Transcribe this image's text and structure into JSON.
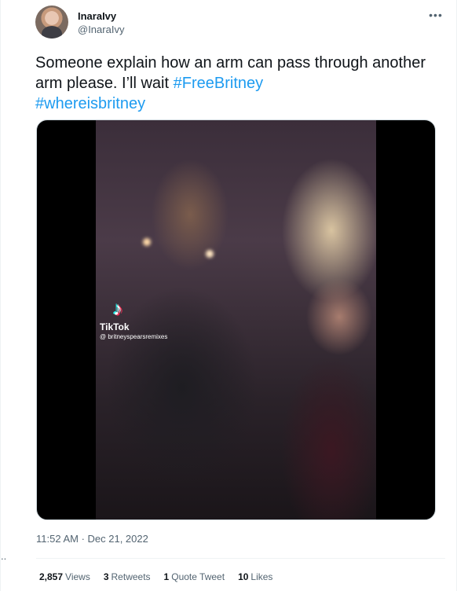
{
  "tweet": {
    "display_name": "InaraIvy",
    "handle": "@InaraIvy",
    "more_icon": "ellipsis-horizontal-icon",
    "text_plain": "Someone explain how an arm can pass through another arm please. I’ll wait ",
    "hashtags": [
      "#FreeBritney",
      "#whereisbritney"
    ],
    "timestamp": "11:52 AM · Dec 21, 2022"
  },
  "media": {
    "watermark_brand": "TikTok",
    "watermark_user": "@ britneyspearsremixes"
  },
  "stats": {
    "views_count": "2,857",
    "views_label": "Views",
    "retweets_count": "3",
    "retweets_label": "Retweets",
    "quotes_count": "1",
    "quotes_label": "Quote Tweet",
    "likes_count": "10",
    "likes_label": "Likes"
  },
  "colors": {
    "link": "#1d9bf0",
    "text": "#0f1419",
    "secondary": "#536471"
  }
}
